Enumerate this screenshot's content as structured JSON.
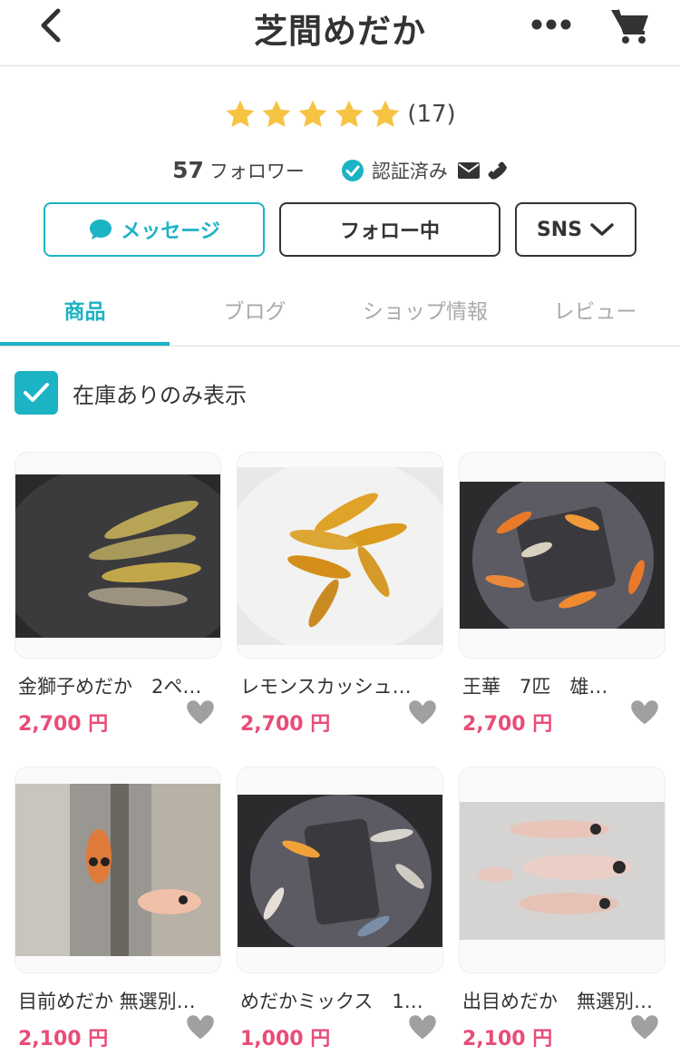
{
  "header": {
    "title": "芝間めだか",
    "back_icon": "chevron-left-icon",
    "more_icon": "more-dots-icon",
    "cart_icon": "cart-icon"
  },
  "rating": {
    "stars": 5,
    "count_text": "(17)",
    "star_color": "#f6c343"
  },
  "shop_info": {
    "followers_count": "57",
    "followers_label": "フォロワー",
    "verified_label": "認証済み",
    "verified_icon": "check-circle-icon",
    "contact_icons": [
      "mail-icon",
      "phone-icon"
    ]
  },
  "actions": {
    "message_label": "メッセージ",
    "follow_label": "フォロー中",
    "sns_label": "SNS"
  },
  "tabs": [
    {
      "label": "商品",
      "active": true
    },
    {
      "label": "ブログ",
      "active": false
    },
    {
      "label": "ショップ情報",
      "active": false
    },
    {
      "label": "レビュー",
      "active": false
    }
  ],
  "filter": {
    "in_stock_only_label": "在庫ありのみ表示",
    "checked": true
  },
  "products": [
    {
      "name": "金獅子めだか　2ペ…",
      "price": "2,700 円",
      "image": "gold-medaka-photo"
    },
    {
      "name": "レモンスカッシュ…",
      "price": "2,700 円",
      "image": "lemon-medaka-photo"
    },
    {
      "name": "王華　7匹　雄…",
      "price": "2,700 円",
      "image": "ouka-medaka-photo"
    },
    {
      "name": "目前めだか 無選別…",
      "price": "2,100 円",
      "image": "memae-medaka-photo"
    },
    {
      "name": "めだかミックス　1…",
      "price": "1,000 円",
      "image": "mix-medaka-photo"
    },
    {
      "name": "出目めだか　無選別…",
      "price": "2,100 円",
      "image": "demé-medaka-photo"
    }
  ],
  "colors": {
    "accent": "#1cb3c4",
    "price": "#e84d77",
    "text": "#333333"
  }
}
